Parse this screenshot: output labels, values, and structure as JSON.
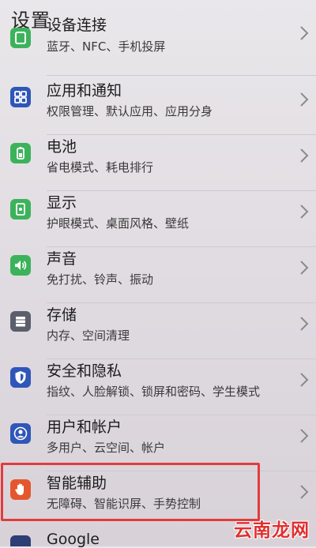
{
  "header": {
    "title": "设置"
  },
  "items": [
    {
      "title": "设备连接",
      "subtitle": "蓝牙、NFC、手机投屏",
      "icon": "device-connection-icon",
      "color": "#3cb35b"
    },
    {
      "title": "应用和通知",
      "subtitle": "权限管理、默认应用、应用分身",
      "icon": "apps-grid-icon",
      "color": "#2f56b8"
    },
    {
      "title": "电池",
      "subtitle": "省电模式、耗电排行",
      "icon": "battery-icon",
      "color": "#3cb35b"
    },
    {
      "title": "显示",
      "subtitle": "护眼模式、桌面风格、壁纸",
      "icon": "display-icon",
      "color": "#3cb35b"
    },
    {
      "title": "声音",
      "subtitle": "免打扰、铃声、振动",
      "icon": "speaker-icon",
      "color": "#3cb35b"
    },
    {
      "title": "存储",
      "subtitle": "内存、空间清理",
      "icon": "storage-icon",
      "color": "#5b5f6b"
    },
    {
      "title": "安全和隐私",
      "subtitle": "指纹、人脸解锁、锁屏和密码、学生模式",
      "icon": "shield-icon",
      "color": "#2f56b8"
    },
    {
      "title": "用户和帐户",
      "subtitle": "多用户、云空间、帐户",
      "icon": "user-icon",
      "color": "#2f56b8"
    },
    {
      "title": "智能辅助",
      "subtitle": "无障碍、智能识屏、手势控制",
      "icon": "hand-icon",
      "color": "#e4572e"
    },
    {
      "title": "Google",
      "subtitle": "",
      "icon": "google-icon",
      "color": "#2c3e73"
    }
  ],
  "watermark": "云南龙网"
}
